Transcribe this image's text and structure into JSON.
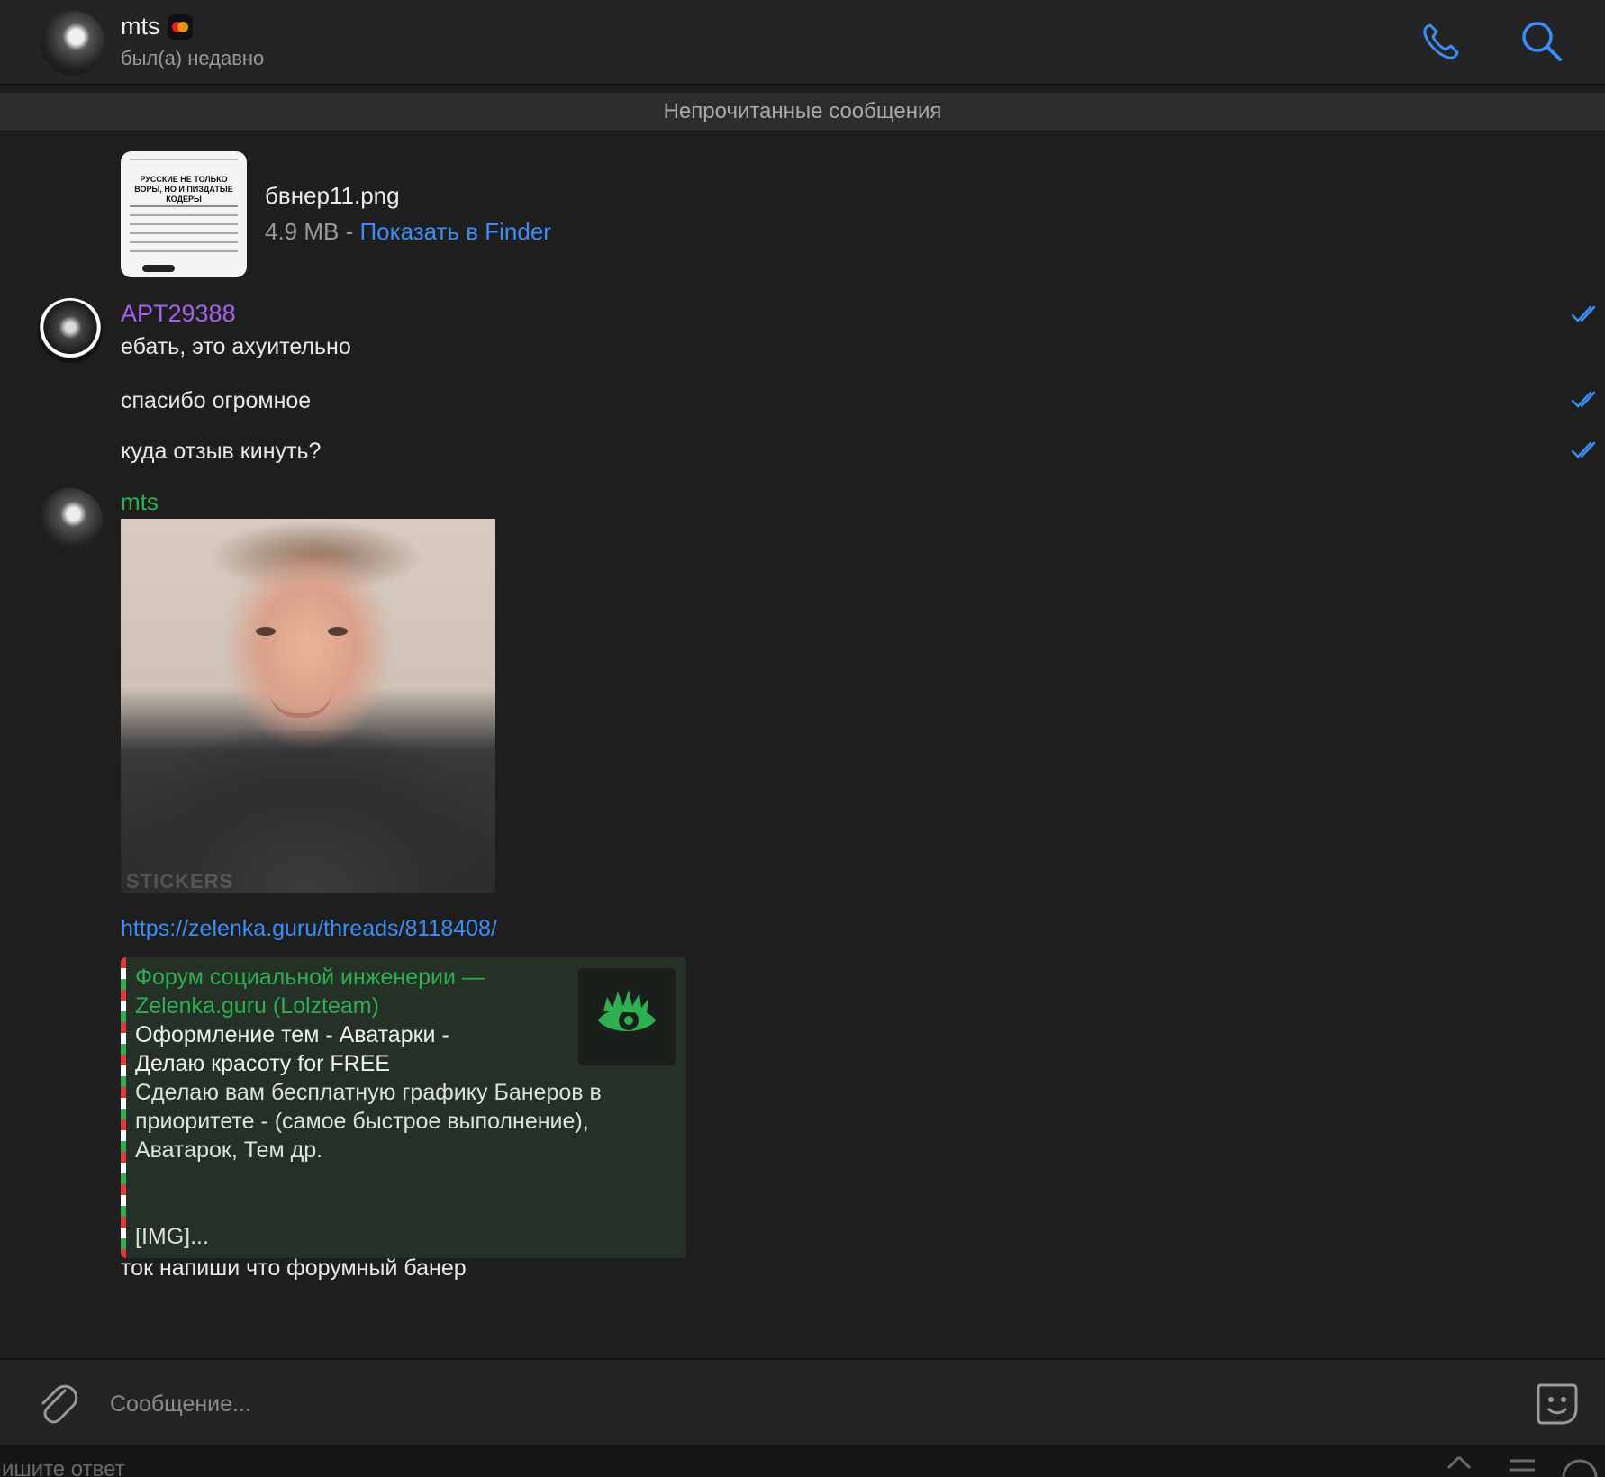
{
  "header": {
    "name": "mts",
    "status": "был(а) недавно",
    "call_icon": "phone-icon",
    "search_icon": "search-icon",
    "accent": "#3a8ef6"
  },
  "unread_divider": "Непрочитанные сообщения",
  "messages": [
    {
      "type": "file",
      "file_name": "бвнер11.png",
      "file_size": "4.9 MB",
      "separator": " - ",
      "action": "Показать в Finder",
      "thumb_text": "РУССКИЕ НЕ ТОЛЬКО ВОРЫ, НО И ПИЗДАТЫЕ КОДЕРЫ"
    },
    {
      "type": "text_group",
      "sender": "APT29388",
      "sender_color": "#a461f0",
      "lines": [
        "ебать, это ахуительно",
        "спасибо огромное",
        "куда отзыв кинуть?"
      ],
      "status_icon": "double-check-icon"
    },
    {
      "type": "media_group",
      "sender": "mts",
      "sender_color": "#2fae52",
      "photo_watermark": "STICKERS",
      "link": "https://zelenka.guru/threads/8118408/",
      "preview": {
        "site": "Форум социальной инженерии — Zelenka.guru (Lolzteam)",
        "title": "Оформление тем - Аватарки - Делаю красоту for FREE",
        "description": "Сделаю вам бесплатную графику Банеров в приоритете - (самое быстрое выполнение), Аватарок, Тем др.",
        "trailer": "[IMG]...",
        "image_icon": "lolz-eye-logo-icon"
      },
      "final_text": "ток напиши что форумный банер"
    }
  ],
  "composer": {
    "placeholder": "Сообщение...",
    "attach_icon": "paperclip-icon",
    "sticker_icon": "sticker-icon"
  },
  "bottom_strip": {
    "hint": "ишите ответ"
  }
}
